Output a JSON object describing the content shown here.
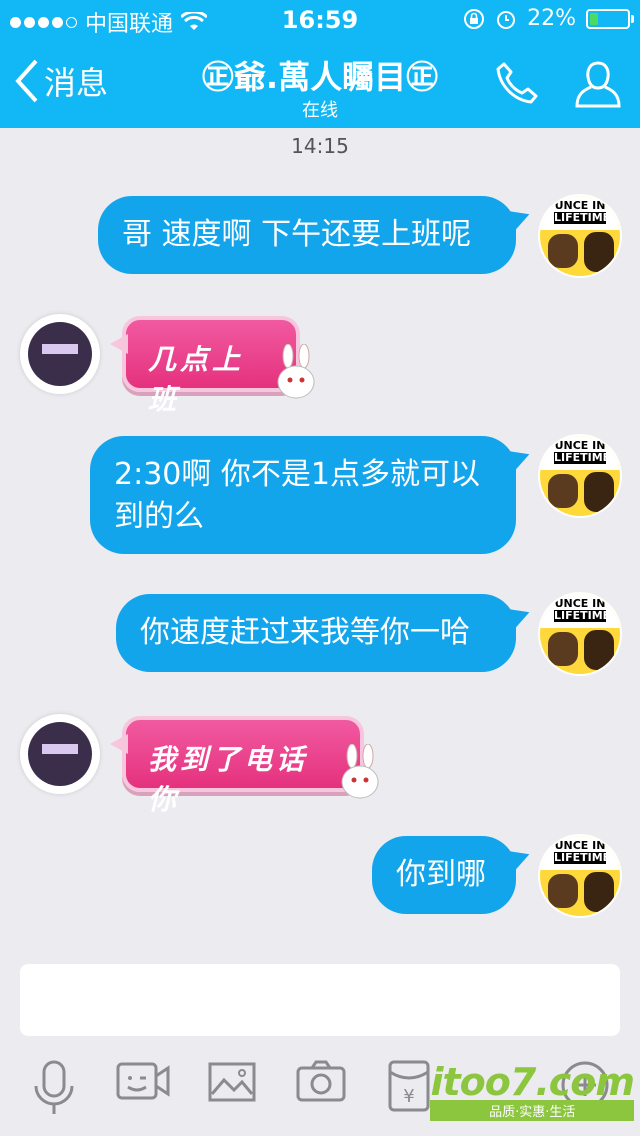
{
  "status": {
    "carrier": "中国联通",
    "time": "16:59",
    "battery_percent": "22%"
  },
  "nav": {
    "back_label": "消息",
    "contact_name": "㊣爺.萬人矚目㊣",
    "status": "在线"
  },
  "timestamp": "14:15",
  "messages": [
    {
      "side": "out",
      "text": "哥 速度啊 下午还要上班呢",
      "avatar_text": [
        "UNCE IN",
        "LIFETIME"
      ]
    },
    {
      "side": "in",
      "text": "几点上班"
    },
    {
      "side": "out",
      "text": "2:30啊 你不是1点多就可以到的么",
      "avatar_text": [
        "UNCE IN",
        "LIFETIME"
      ]
    },
    {
      "side": "out",
      "text": "你速度赶过来我等你一哈",
      "avatar_text": [
        "UNCE IN",
        "LIFETIME"
      ]
    },
    {
      "side": "in",
      "text": "我到了电话你"
    },
    {
      "side": "out",
      "text": "你到哪",
      "avatar_text": [
        "UNCE IN",
        "LIFETIME"
      ]
    }
  ],
  "watermark": {
    "logo": "itoo7.com",
    "tagline": "品质·实惠·生活"
  },
  "colors": {
    "accent": "#12b7f5",
    "outgoing_bubble": "#12a5ec",
    "incoming_bubble": "#e5317e"
  }
}
